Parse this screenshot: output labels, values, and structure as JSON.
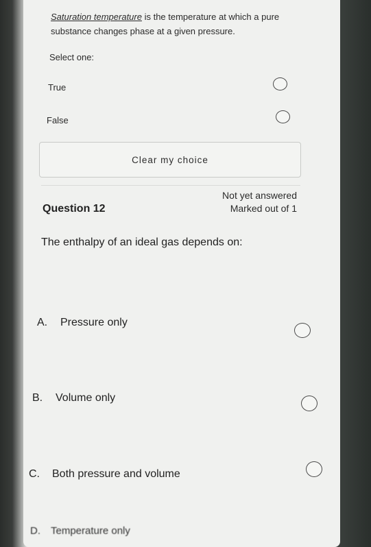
{
  "question_11": {
    "term": "Saturation temperature",
    "text_rest": " is the temperature at which a pure substance changes phase at a given pressure.",
    "prompt": "Select one:",
    "options": [
      {
        "label": "True"
      },
      {
        "label": "False"
      }
    ],
    "clear_label": "Clear my choice"
  },
  "question_12": {
    "heading": "Question 12",
    "status": "Not yet answered",
    "marks": "Marked out of 1",
    "text": "The enthalpy of an ideal gas depends on:",
    "options": [
      {
        "letter": "A.",
        "label": "Pressure only"
      },
      {
        "letter": "B.",
        "label": "Volume only"
      },
      {
        "letter": "C.",
        "label": "Both pressure and volume"
      },
      {
        "letter": "D.",
        "label": "Temperature only"
      }
    ]
  }
}
